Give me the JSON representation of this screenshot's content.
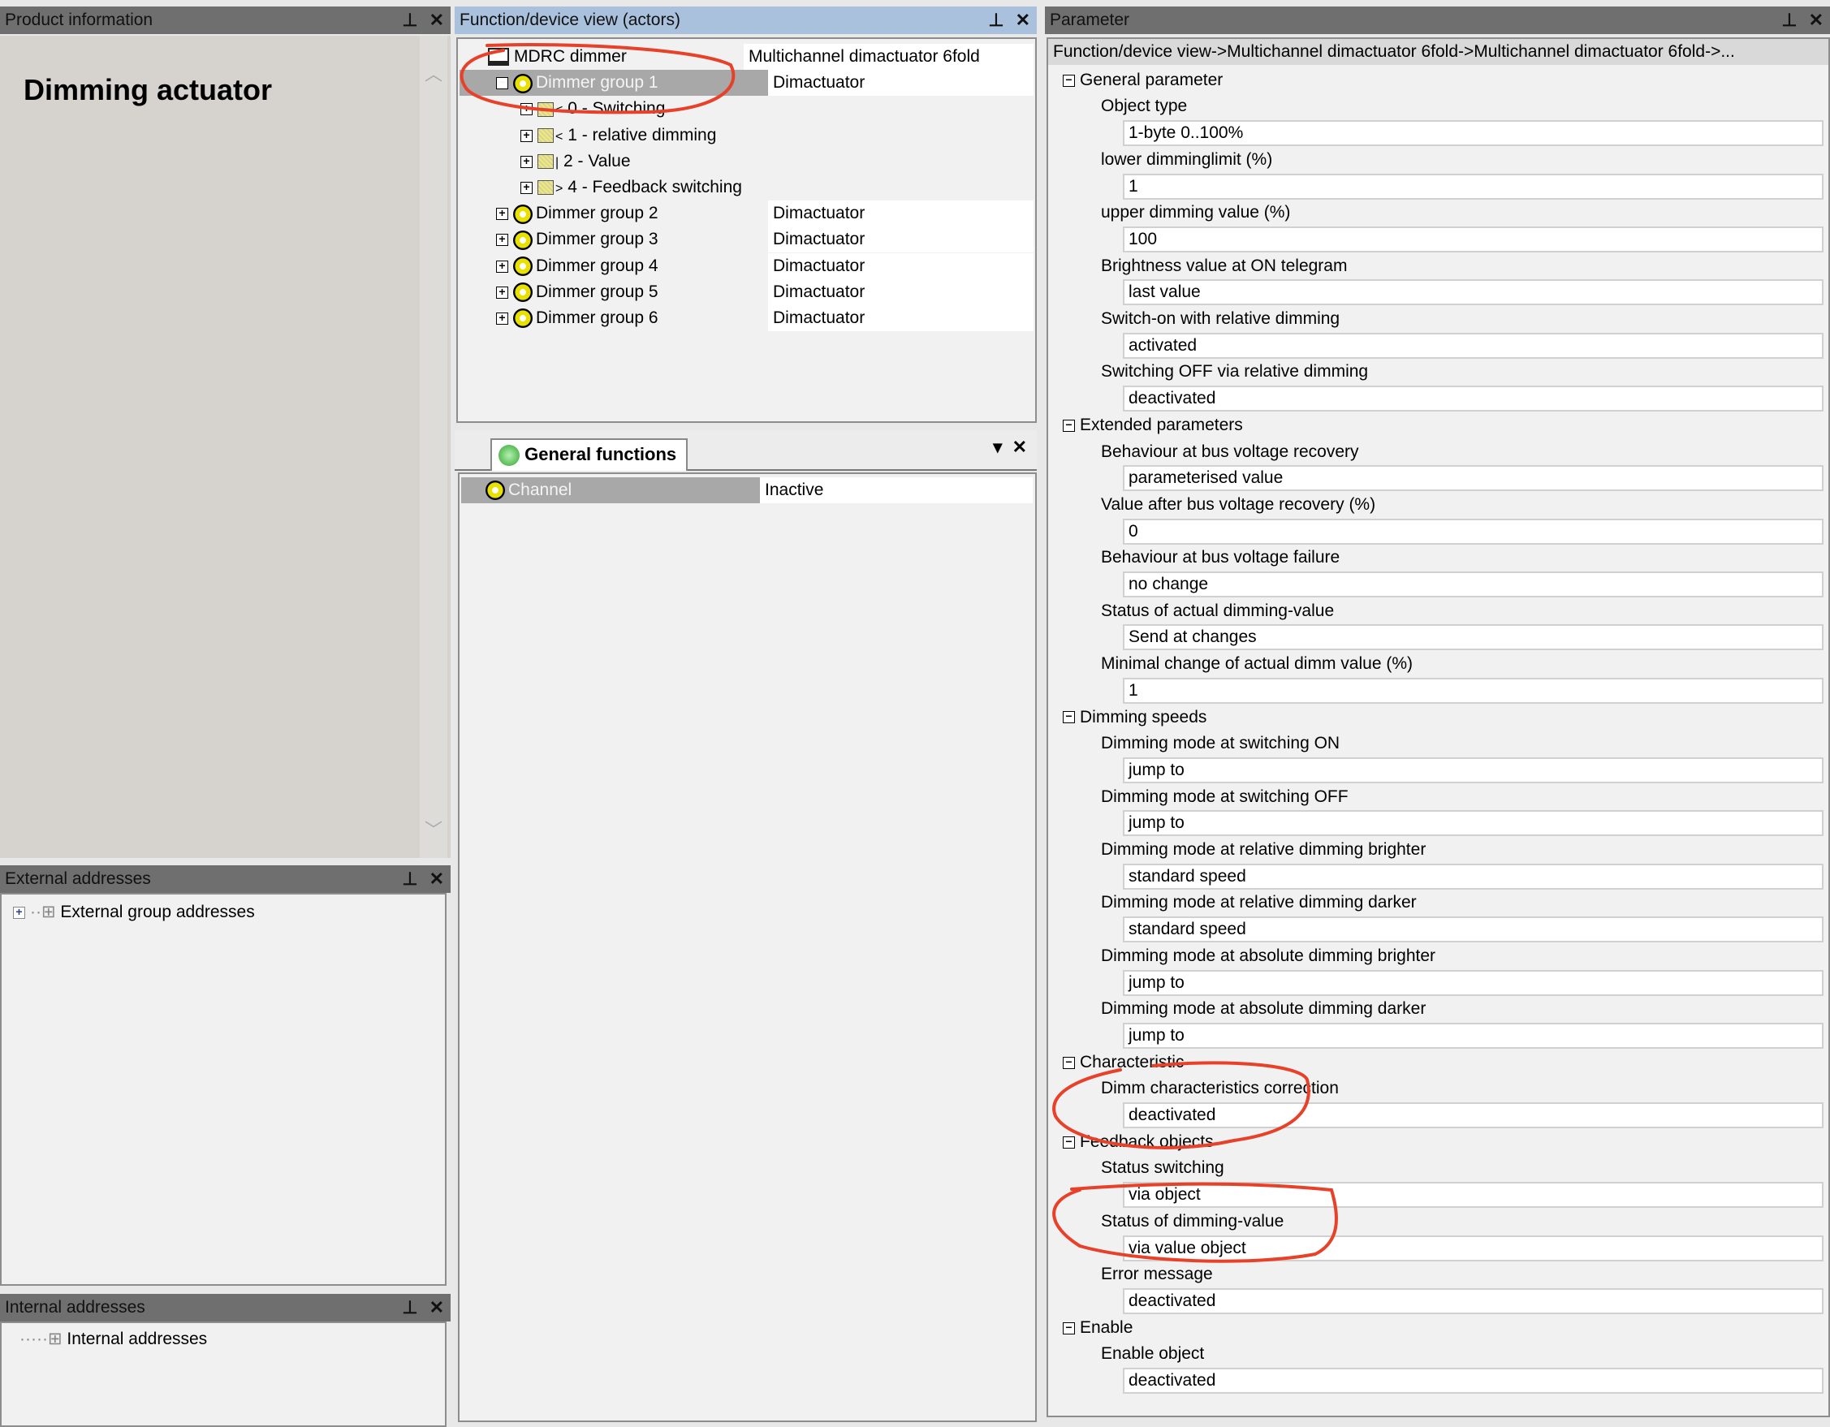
{
  "product_info": {
    "title": "Product information",
    "heading": "Dimming actuator"
  },
  "external": {
    "title": "External addresses",
    "item": "External group addresses"
  },
  "internal": {
    "title": "Internal addresses",
    "item": "Internal addresses"
  },
  "device_view": {
    "title": "Function/device view (actors)",
    "tree": [
      {
        "label": "MDRC dimmer",
        "type": "Multichannel dimactuator 6fold",
        "level": 0,
        "icon": "device-icon",
        "exp": ""
      },
      {
        "label": "Dimmer group 1",
        "type": "Dimactuator",
        "level": 1,
        "icon": "gear-icon",
        "exp": "-",
        "selected": true
      },
      {
        "label": "0 - Switching",
        "type": "",
        "level": 2,
        "icon": "object-icon",
        "exp": "+",
        "arrow": "<"
      },
      {
        "label": "1 - relative dimming",
        "type": "",
        "level": 2,
        "icon": "object-icon",
        "exp": "+",
        "arrow": "<"
      },
      {
        "label": "2 - Value",
        "type": "",
        "level": 2,
        "icon": "object-icon",
        "exp": "+",
        "arrow": "|"
      },
      {
        "label": "4 - Feedback switching",
        "type": "",
        "level": 2,
        "icon": "object-icon",
        "exp": "+",
        "arrow": ">"
      },
      {
        "label": "Dimmer group 2",
        "type": "Dimactuator",
        "level": 1,
        "icon": "gear-icon",
        "exp": "+"
      },
      {
        "label": "Dimmer group 3",
        "type": "Dimactuator",
        "level": 1,
        "icon": "gear-icon",
        "exp": "+"
      },
      {
        "label": "Dimmer group 4",
        "type": "Dimactuator",
        "level": 1,
        "icon": "gear-icon",
        "exp": "+"
      },
      {
        "label": "Dimmer group 5",
        "type": "Dimactuator",
        "level": 1,
        "icon": "gear-icon",
        "exp": "+"
      },
      {
        "label": "Dimmer group 6",
        "type": "Dimactuator",
        "level": 1,
        "icon": "gear-icon",
        "exp": "+"
      }
    ]
  },
  "general_functions": {
    "tab": "General functions",
    "rows": [
      {
        "label": "Channel",
        "value": "Inactive"
      }
    ]
  },
  "parameter": {
    "title": "Parameter",
    "breadcrumb": "Function/device view->Multichannel dimactuator 6fold->Multichannel dimactuator 6fold->...",
    "groups": [
      {
        "name": "General parameter",
        "params": [
          {
            "label": "Object type",
            "value": "1-byte 0..100%"
          },
          {
            "label": "lower dimminglimit (%)",
            "value": "1"
          },
          {
            "label": "upper dimming value (%)",
            "value": "100"
          },
          {
            "label": "Brightness value at ON telegram",
            "value": "last value"
          },
          {
            "label": "Switch-on with relative dimming",
            "value": "activated"
          },
          {
            "label": "Switching OFF via relative dimming",
            "value": "deactivated"
          }
        ]
      },
      {
        "name": "Extended parameters",
        "params": [
          {
            "label": "Behaviour at bus voltage recovery",
            "value": "parameterised value"
          },
          {
            "label": "Value after bus voltage recovery (%)",
            "value": "0"
          },
          {
            "label": "Behaviour at bus voltage failure",
            "value": "no change"
          },
          {
            "label": "Status of actual dimming-value",
            "value": "Send at changes"
          },
          {
            "label": "Minimal change of actual dimm value (%)",
            "value": "1"
          }
        ]
      },
      {
        "name": "Dimming speeds",
        "params": [
          {
            "label": "Dimming mode at switching ON",
            "value": "jump to"
          },
          {
            "label": "Dimming mode at switching OFF",
            "value": "jump to"
          },
          {
            "label": "Dimming mode at relative dimming brighter",
            "value": "standard speed"
          },
          {
            "label": "Dimming mode at relative dimming darker",
            "value": "standard speed"
          },
          {
            "label": "Dimming mode at absolute dimming brighter",
            "value": "jump to"
          },
          {
            "label": "Dimming mode at absolute dimming darker",
            "value": "jump to"
          }
        ]
      },
      {
        "name": "Characteristic",
        "params": [
          {
            "label": "Dimm characteristics correction",
            "value": "deactivated"
          }
        ]
      },
      {
        "name": "Feedback objects",
        "params": [
          {
            "label": "Status switching",
            "value": "via object"
          },
          {
            "label": "Status of dimming-value",
            "value": "via value object"
          },
          {
            "label": "Error message",
            "value": "deactivated"
          }
        ]
      },
      {
        "name": "Enable",
        "params": [
          {
            "label": "Enable object",
            "value": "deactivated"
          }
        ]
      }
    ]
  },
  "colors": {
    "annotation": "#e8412a",
    "header": "#6f6f6f",
    "active_header": "#a9c1dc",
    "selection": "#a8a8a8"
  }
}
